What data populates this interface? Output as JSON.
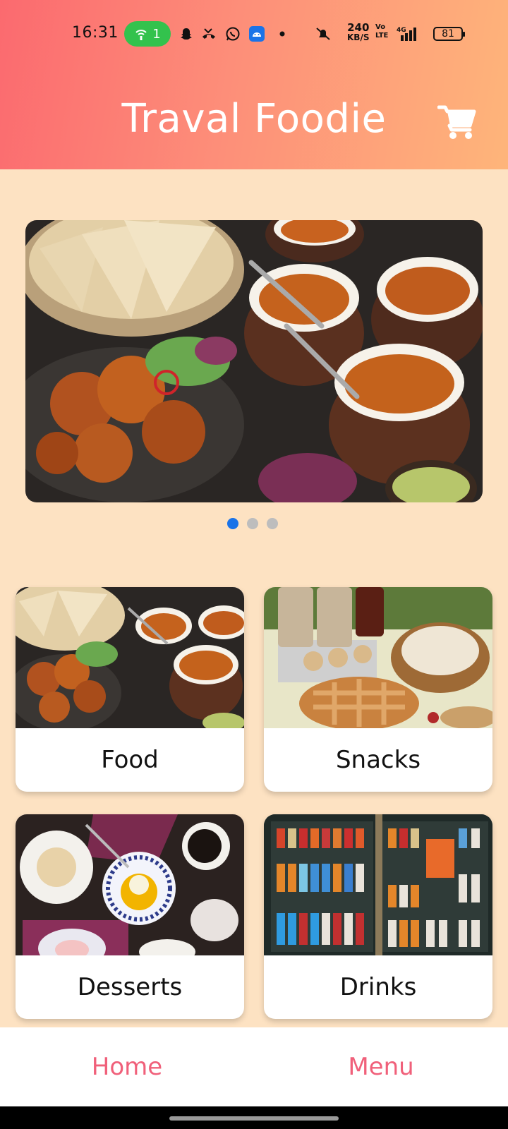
{
  "status_bar": {
    "time": "16:31",
    "hotspot_count": "1",
    "net_speed_value": "240",
    "net_speed_unit": "KB/S",
    "volte_top": "Vo",
    "volte_bottom": "LTE",
    "network": "4G",
    "battery": "81"
  },
  "header": {
    "title": "Traval Foodie",
    "cart_icon": "cart-icon"
  },
  "carousel": {
    "active_index": 0,
    "slide_count": 3
  },
  "categories": [
    {
      "label": "Food"
    },
    {
      "label": "Snacks"
    },
    {
      "label": "Desserts"
    },
    {
      "label": "Drinks"
    }
  ],
  "bottom_nav": {
    "home": "Home",
    "menu": "Menu",
    "color": "#f0607a"
  },
  "colors": {
    "header_start": "#fb6a6f",
    "header_end": "#feb57a",
    "page_bg": "#fde2c2",
    "dot_active": "#1a73e8"
  }
}
